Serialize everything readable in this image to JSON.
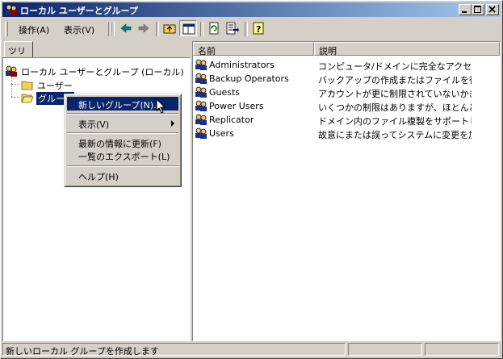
{
  "window": {
    "title": "ローカル ユーザーとグループ",
    "controls": {
      "minimize": "minimize",
      "maximize": "maximize",
      "close": "close"
    }
  },
  "menubar": {
    "items": [
      {
        "label": "操作(A)"
      },
      {
        "label": "表示(V)"
      }
    ],
    "toolbar_icons": [
      "back-arrow-icon",
      "forward-arrow-icon",
      "up-folder-icon",
      "show-hide-tree-icon",
      "refresh-icon",
      "export-list-icon",
      "help-icon"
    ]
  },
  "tree": {
    "tab_label": "ツリー",
    "root": "ローカル ユーザーとグループ (ローカル)",
    "children": [
      {
        "label": "ユーザー"
      },
      {
        "label": "グループ"
      }
    ]
  },
  "list": {
    "columns": [
      "名前",
      "説明"
    ],
    "rows": [
      {
        "name": "Administrators",
        "desc": "コンピュータ/ドメインに完全なアクセス..."
      },
      {
        "name": "Backup Operators",
        "desc": "バックアップの作成またはファイルを復元..."
      },
      {
        "name": "Guests",
        "desc": "アカウントが更に制限されていないかぎ..."
      },
      {
        "name": "Power Users",
        "desc": "いくつかの制限はありますが、ほとんどの..."
      },
      {
        "name": "Replicator",
        "desc": "ドメイン内のファイル複製をサポートしま..."
      },
      {
        "name": "Users",
        "desc": "故意にまたは誤ってシステムに変更を加..."
      }
    ]
  },
  "context_menu": {
    "new_group": "新しいグループ(N)...",
    "view": "表示(V)",
    "refresh": "最新の情報に更新(F)",
    "export": "一覧のエクスポート(L)",
    "help": "ヘルプ(H)"
  },
  "status": {
    "text": "新しいローカル グループを作成します"
  },
  "colors": {
    "title_start": "#0a246a",
    "title_end": "#a6caf0",
    "selection": "#0a246a",
    "face": "#d4d0c8"
  }
}
